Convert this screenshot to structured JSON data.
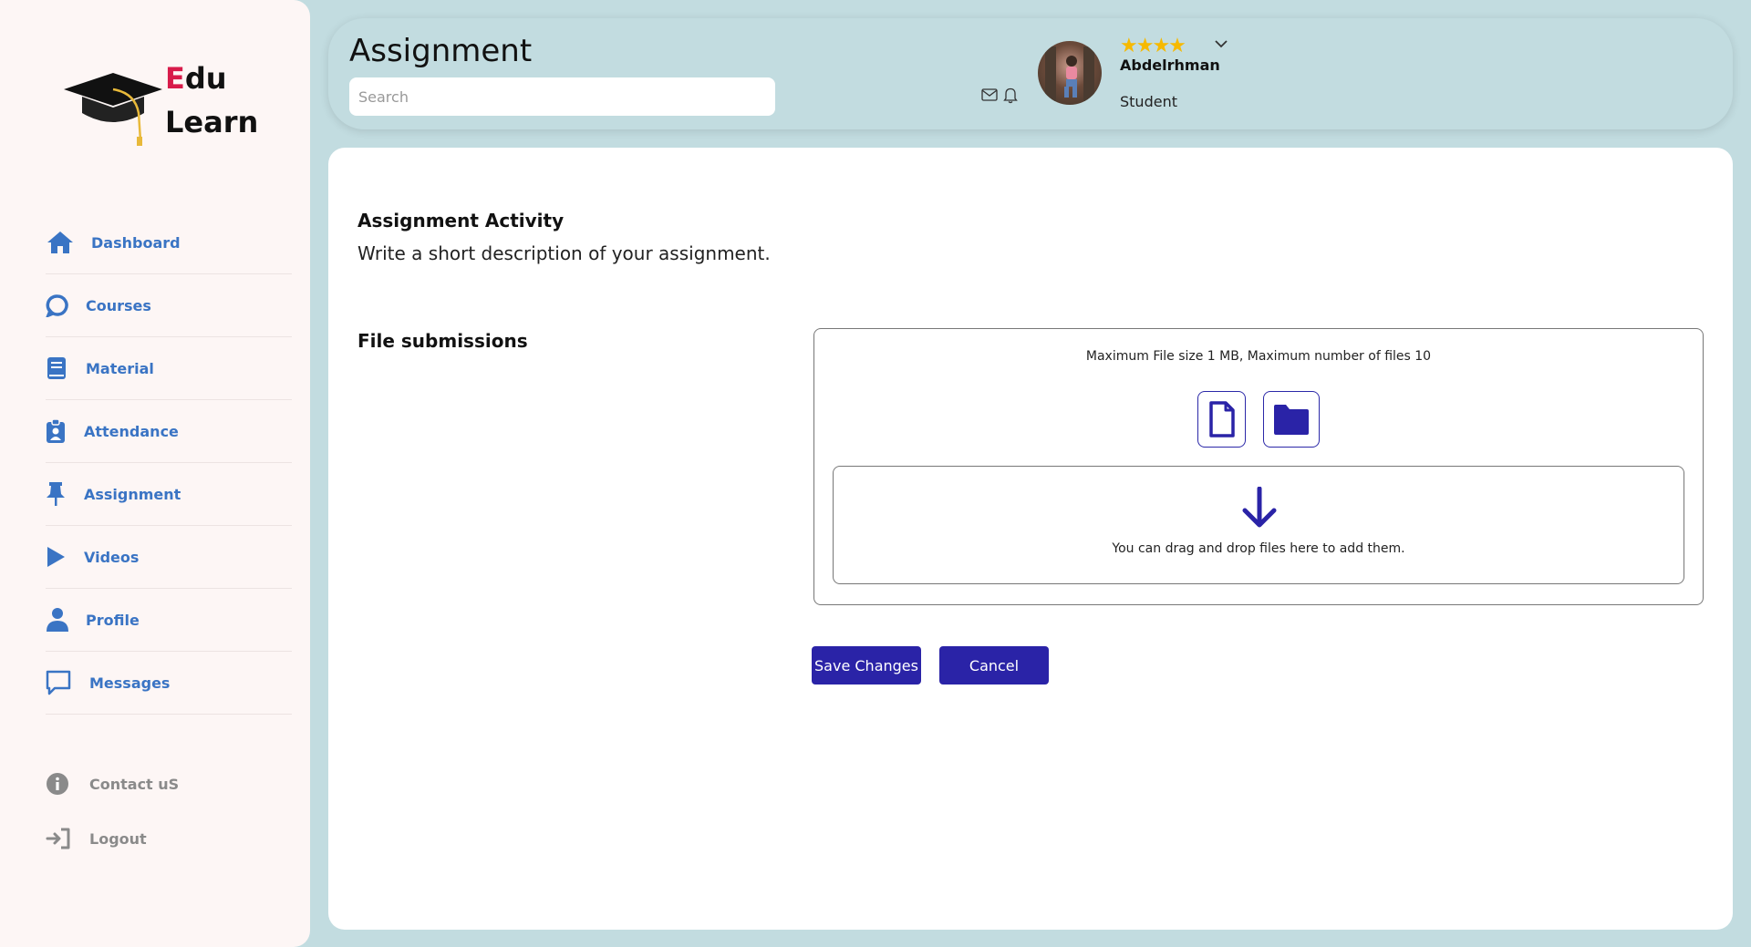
{
  "brand": {
    "line1_accent": "E",
    "line1_rest": "du",
    "line2": "Learn"
  },
  "sidebar": {
    "items": [
      {
        "label": "Dashboard",
        "icon": "home-icon"
      },
      {
        "label": "Courses",
        "icon": "chat-bubble-icon"
      },
      {
        "label": "Material",
        "icon": "book-icon"
      },
      {
        "label": "Attendance",
        "icon": "clipboard-icon"
      },
      {
        "label": "Assignment",
        "icon": "pin-icon"
      },
      {
        "label": "Videos",
        "icon": "play-icon"
      },
      {
        "label": "Profile",
        "icon": "user-icon"
      },
      {
        "label": "Messages",
        "icon": "message-icon"
      }
    ],
    "bottom": [
      {
        "label": "Contact uS",
        "icon": "info-icon"
      },
      {
        "label": "Logout",
        "icon": "logout-icon"
      }
    ]
  },
  "header": {
    "title": "Assignment",
    "search_placeholder": "Search",
    "user": {
      "name": "Abdelrhman",
      "role": "Student",
      "stars": "★★★★",
      "rating": 4
    }
  },
  "main": {
    "activity_title": "Assignment Activity",
    "activity_desc": "Write a short description of your assignment.",
    "submissions_title": "File submissions",
    "limits": "Maximum File size 1 MB, Maximum number of files 10",
    "drop_text": "You can drag and drop files here to add them.",
    "save_label": "Save Changes",
    "cancel_label": "Cancel"
  },
  "colors": {
    "accent_blue": "#2a23a7",
    "nav_blue": "#3a74c4",
    "brand_red": "#d81b4a",
    "star_gold": "#f6b900",
    "background": "#c2dce0"
  }
}
